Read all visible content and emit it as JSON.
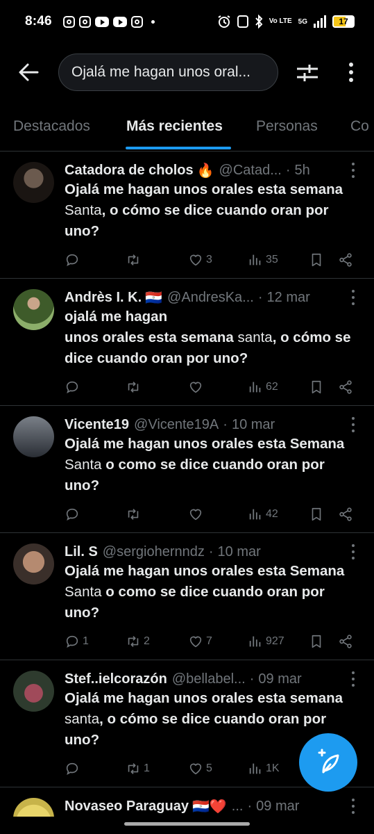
{
  "status_bar": {
    "time": "8:46",
    "network": "5G",
    "volte": "Vo LTE",
    "battery": "17",
    "app_icons": [
      "instagram-icon",
      "instagram-icon",
      "youtube-icon",
      "youtube-icon",
      "instagram-icon"
    ]
  },
  "header": {
    "search_query": "Ojalá me hagan unos oral..."
  },
  "tabs": [
    {
      "label": "Destacados",
      "active": false
    },
    {
      "label": "Más recientes",
      "active": true
    },
    {
      "label": "Personas",
      "active": false
    },
    {
      "label": "Co",
      "active": false
    }
  ],
  "posts": [
    {
      "name": "Catadora de cholos",
      "emoji": "🔥",
      "handle": "@Catad...",
      "time": "5h",
      "text": [
        {
          "bold": "Ojalá me hagan unos orales esta semana "
        },
        {
          "normal": "Santa"
        },
        {
          "bold": ", o cómo se dice cuando oran por uno?"
        }
      ],
      "replies": "",
      "retweets": "",
      "likes": "3",
      "views": "35"
    },
    {
      "name": "Andrès I. K.",
      "emoji": "🇵🇾",
      "handle": "@AndresKa...",
      "time": "12 mar",
      "text": [
        {
          "bold": "ojalá me hagan"
        },
        {
          "br": ""
        },
        {
          "bold": "unos orales esta semana "
        },
        {
          "normal": "santa"
        },
        {
          "bold": ", o cómo se dice cuando oran por uno?"
        }
      ],
      "replies": "",
      "retweets": "",
      "likes": "",
      "views": "62"
    },
    {
      "name": "Vicente19",
      "emoji": "",
      "handle": "@Vicente19A",
      "time": "10 mar",
      "text": [
        {
          "bold": "Ojalá me hagan unos orales esta Semana "
        },
        {
          "normal": "Santa"
        },
        {
          "bold": " o como se dice cuando oran por uno?"
        }
      ],
      "replies": "",
      "retweets": "",
      "likes": "",
      "views": "42"
    },
    {
      "name": "Lil. S",
      "emoji": "",
      "handle": "@sergiohernndz",
      "time": "10 mar",
      "text": [
        {
          "bold": "Ojalá me hagan unos orales esta Semana "
        },
        {
          "normal": "Santa"
        },
        {
          "bold": " o como se dice cuando oran por uno?"
        }
      ],
      "replies": "1",
      "retweets": "2",
      "likes": "7",
      "views": "927"
    },
    {
      "name": "Stef..ielcorazón",
      "emoji": "",
      "handle": "@bellabel...",
      "time": "09 mar",
      "text": [
        {
          "bold": "Ojalá me hagan unos orales esta semana "
        },
        {
          "normal": "santa"
        },
        {
          "bold": ", o cómo se dice cuando oran por uno?"
        }
      ],
      "replies": "",
      "retweets": "1",
      "likes": "5",
      "views": "1K"
    },
    {
      "name": "Novaseo Paraguay",
      "emoji": "🇵🇾❤️",
      "handle": "...",
      "time": "09 mar",
      "text": [],
      "replies": "",
      "retweets": "",
      "likes": "",
      "views": ""
    }
  ],
  "colors": {
    "background": "#000000",
    "text": "#e7e9ea",
    "muted": "#71767b",
    "accent": "#1d9bf0",
    "divider": "#2f3336"
  }
}
